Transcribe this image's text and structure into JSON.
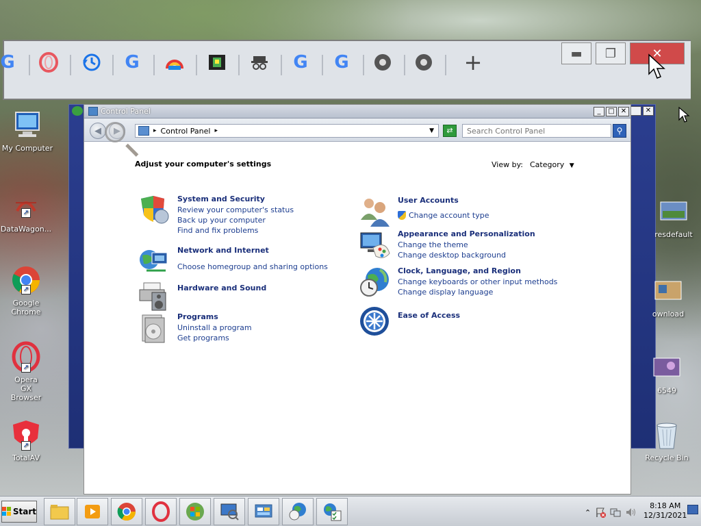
{
  "window": {
    "title": "Control Panel",
    "breadcrumb": "Control Panel",
    "search_placeholder": "Search Control Panel",
    "heading": "Adjust your computer's settings",
    "view_by_label": "View by:",
    "view_by_value": "Category"
  },
  "categories_left": [
    {
      "title": "System and Security",
      "icon": "shield-icon",
      "links": [
        "Review your computer's status",
        "Back up your computer",
        "Find and fix problems"
      ]
    },
    {
      "title": "Network and Internet",
      "icon": "network-globe-icon",
      "links": [
        "Choose homegroup and sharing options"
      ]
    },
    {
      "title": "Hardware and Sound",
      "icon": "printer-speaker-icon",
      "links": []
    },
    {
      "title": "Programs",
      "icon": "programs-disc-icon",
      "links": [
        "Uninstall a program",
        "Get programs"
      ]
    }
  ],
  "categories_right": [
    {
      "title": "User Accounts",
      "icon": "users-icon",
      "links": [
        "Change account type"
      ]
    },
    {
      "title": "Appearance and Personalization",
      "icon": "monitor-palette-icon",
      "links": [
        "Change the theme",
        "Change desktop background"
      ]
    },
    {
      "title": "Clock, Language, and Region",
      "icon": "globe-clock-icon",
      "links": [
        "Change keyboards or other input methods",
        "Change display language"
      ]
    },
    {
      "title": "Ease of Access",
      "icon": "ease-of-access-icon",
      "links": []
    }
  ],
  "desktop_icons_left": [
    "My Computer",
    "DataWagon...",
    "Google Chrome",
    "Opera GX Browser",
    "TotalAV"
  ],
  "desktop_icons_right": [
    "resdefault",
    "ownload",
    "6549",
    "Recycle Bin"
  ],
  "taskbar": {
    "start_label": "Start",
    "time": "8:18 AM",
    "date": "12/31/2021"
  },
  "colors": {
    "link": "#1c3d8f",
    "title_link": "#1a2f7a",
    "window_frame": "#2b3e8f"
  }
}
